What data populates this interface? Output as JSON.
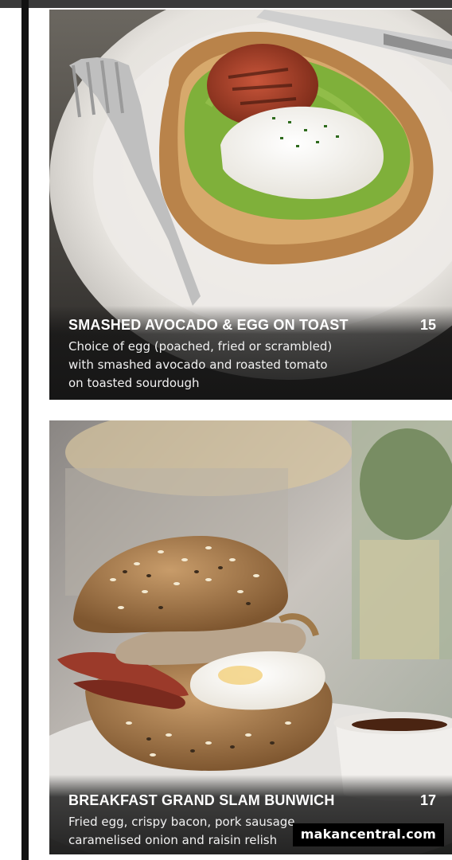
{
  "menu": {
    "items": [
      {
        "name": "SMASHED AVOCADO & EGG ON TOAST",
        "price": "15",
        "description_lines": [
          "Choice of egg (poached, fried or scrambled)",
          "with smashed avocado and roasted tomato",
          "on toasted sourdough"
        ],
        "image_icon": "avocado-toast-photo"
      },
      {
        "name": "BREAKFAST GRAND SLAM BUNWICH",
        "price": "17",
        "description_lines": [
          "Fried egg, crispy bacon, pork sausage,",
          "caramelised onion and raisin relish"
        ],
        "image_icon": "bunwich-photo"
      }
    ]
  },
  "watermark": {
    "text": "makancentral.com"
  },
  "colors": {
    "caption_text": "#ffffff",
    "caption_bg": "#1e1e1e",
    "avocado": "#7fb03a",
    "toast": "#b9834a",
    "bun": "#b88b5a"
  }
}
